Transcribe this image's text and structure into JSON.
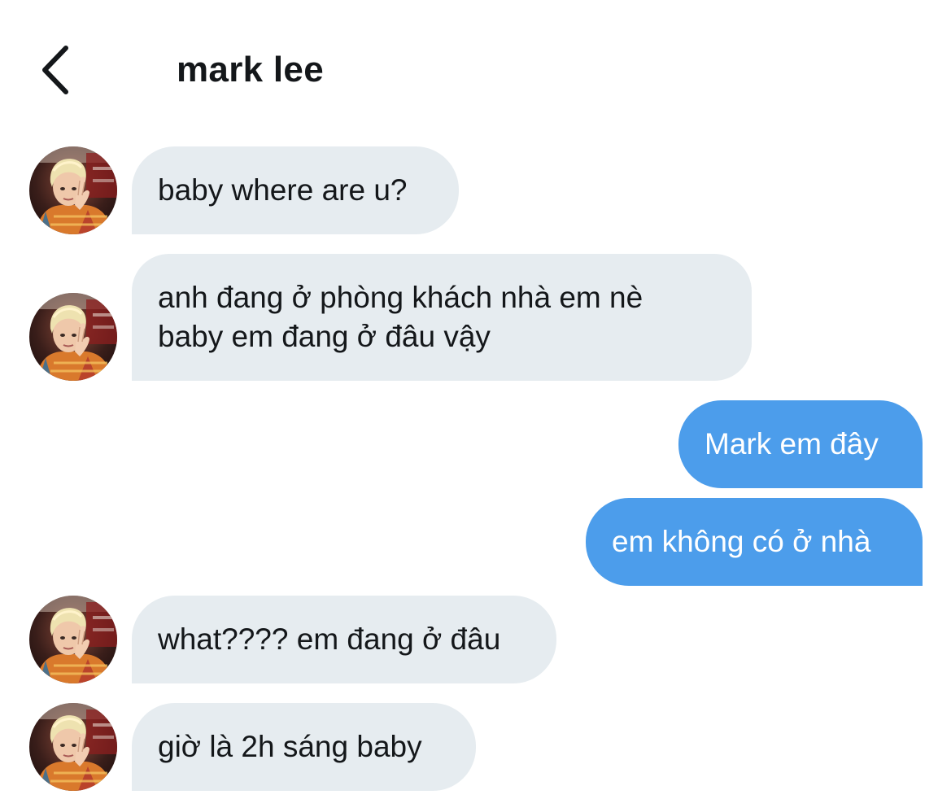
{
  "header": {
    "back_icon": "chevron-left-icon",
    "title": "mark lee"
  },
  "messages": [
    {
      "direction": "incoming",
      "lines": [
        "baby where are u?"
      ]
    },
    {
      "direction": "incoming",
      "lines": [
        "anh đang ở phòng khách nhà em nè",
        "baby em đang ở đâu vậy"
      ]
    },
    {
      "direction": "outgoing",
      "lines": [
        "Mark em đây"
      ]
    },
    {
      "direction": "outgoing",
      "lines": [
        "em không có ở nhà"
      ]
    },
    {
      "direction": "incoming",
      "lines": [
        "what???? em đang ở đâu"
      ]
    },
    {
      "direction": "incoming",
      "lines": [
        "giờ là 2h sáng baby"
      ]
    }
  ],
  "colors": {
    "incoming_bubble": "#e6ecf0",
    "outgoing_bubble": "#4c9deb",
    "text_dark": "#14171a",
    "text_light": "#ffffff"
  }
}
